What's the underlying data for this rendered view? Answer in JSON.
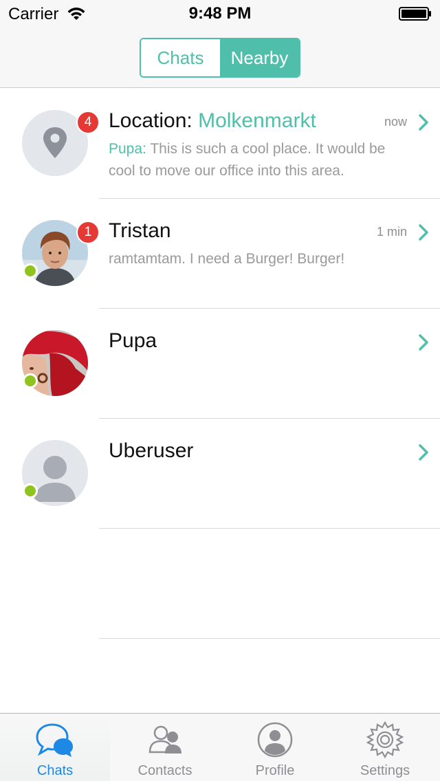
{
  "status_bar": {
    "carrier": "Carrier",
    "time": "9:48 PM"
  },
  "nav": {
    "segments": [
      "Chats",
      "Nearby"
    ],
    "selected": "Nearby"
  },
  "chats": [
    {
      "title_prefix": "Location: ",
      "title_accent": "Molkenmarkt",
      "time": "now",
      "badge": "4",
      "sender": "Pupa:",
      "message": " This is such a cool place. It would be cool to move our office into this area.",
      "avatar": "location-pin"
    },
    {
      "title_prefix": "Tristan",
      "title_accent": "",
      "time": "1 min",
      "badge": "1",
      "sender": "",
      "message": "ramtamtam. I need a Burger!  Burger!",
      "avatar": "photo",
      "online": true
    },
    {
      "title_prefix": "Pupa",
      "title_accent": "",
      "time": "",
      "badge": "",
      "sender": "",
      "message": "",
      "avatar": "photo",
      "online": true
    },
    {
      "title_prefix": "Uberuser",
      "title_accent": "",
      "time": "",
      "badge": "",
      "sender": "",
      "message": "",
      "avatar": "placeholder",
      "online": true
    }
  ],
  "tabs": [
    {
      "label": "Chats",
      "icon": "chat-bubbles-icon",
      "active": true
    },
    {
      "label": "Contacts",
      "icon": "contacts-icon",
      "active": false
    },
    {
      "label": "Profile",
      "icon": "profile-icon",
      "active": false
    },
    {
      "label": "Settings",
      "icon": "gear-icon",
      "active": false
    }
  ],
  "colors": {
    "accent": "#4fbfab",
    "badge": "#e53935",
    "online": "#8fc31f",
    "tab_active": "#1e88e5"
  }
}
